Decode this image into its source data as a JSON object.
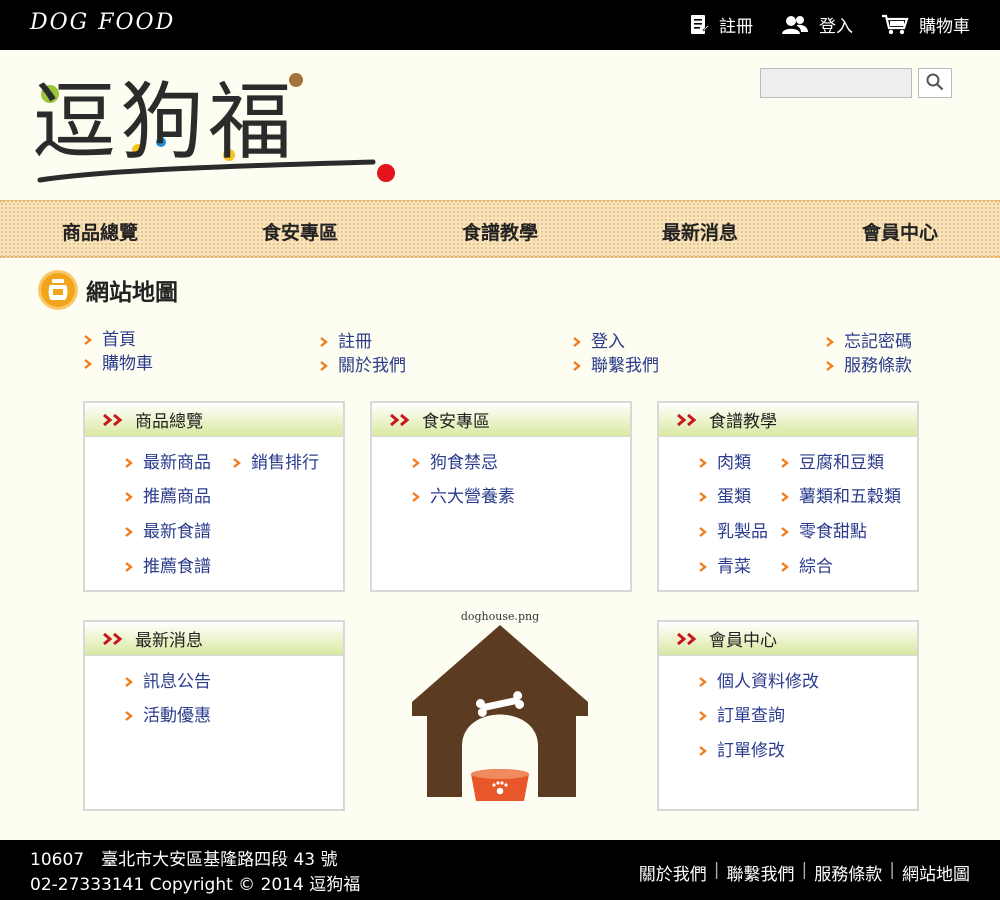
{
  "topbar": {
    "brand": "DOG FOOD",
    "register": "註冊",
    "login": "登入",
    "cart": "購物車"
  },
  "logo": {
    "text": "逗狗福"
  },
  "search": {
    "placeholder": ""
  },
  "main_nav": [
    "商品總覽",
    "食安專區",
    "食譜教學",
    "最新消息",
    "會員中心"
  ],
  "page": {
    "title": "網站地圖"
  },
  "quick_links": [
    [
      "首頁",
      "購物車"
    ],
    [
      "註冊",
      "關於我們"
    ],
    [
      "登入",
      "聯繫我們"
    ],
    [
      "忘記密碼",
      "服務條款"
    ]
  ],
  "panels": {
    "products": {
      "title": "商品總覽",
      "items": [
        "最新商品",
        "推薦商品",
        "最新食譜",
        "推薦食譜"
      ],
      "extra": "銷售排行"
    },
    "food_safety": {
      "title": "食安專區",
      "items": [
        "狗食禁忌",
        "六大營養素"
      ]
    },
    "recipes": {
      "title": "食譜教學",
      "col1": [
        "肉類",
        "蛋類",
        "乳製品",
        "青菜"
      ],
      "col2": [
        "豆腐和豆類",
        "薯類和五穀類",
        "零食甜點",
        "綜合"
      ]
    },
    "news": {
      "title": "最新消息",
      "items": [
        "訊息公告",
        "活動優惠"
      ]
    },
    "member": {
      "title": "會員中心",
      "items": [
        "個人資料修改",
        "訂單查詢",
        "訂單修改"
      ]
    }
  },
  "doghouse": {
    "caption": "doghouse.png"
  },
  "footer": {
    "line1": "10607　臺北市大安區基隆路四段 43 號",
    "line2": "02-27333141  Copyright © 2014 逗狗福",
    "links": [
      "關於我們",
      "聯繫我們",
      "服務條款",
      "網站地圖"
    ]
  },
  "colors": {
    "accent_orange": "#f2a41b",
    "link_blue": "#2c3c8c",
    "arrow_orange": "#f07d1e",
    "panel_head_green": "#d7e8a2",
    "doghouse_brown": "#5b3b21",
    "bowl_orange": "#e8572a"
  }
}
